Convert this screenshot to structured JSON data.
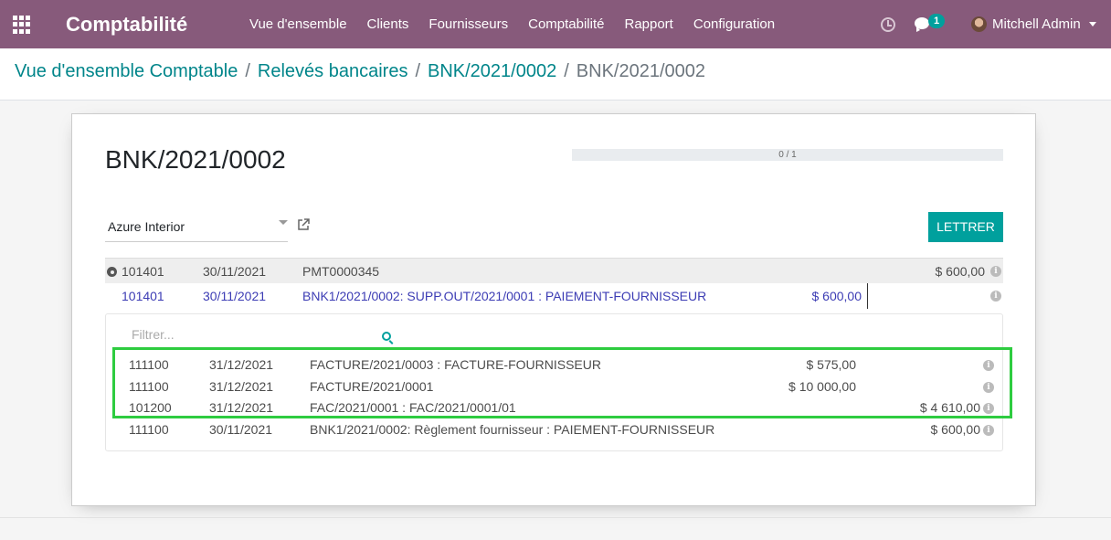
{
  "navbar": {
    "app_title": "Comptabilité",
    "menu": [
      "Vue d'ensemble",
      "Clients",
      "Fournisseurs",
      "Comptabilité",
      "Rapport",
      "Configuration"
    ],
    "chat_badge": "1",
    "user_name": "Mitchell Admin"
  },
  "breadcrumb": {
    "items": [
      "Vue d'ensemble Comptable",
      "Relevés bancaires",
      "BNK/2021/0002"
    ],
    "current": "BNK/2021/0002",
    "separator": "/"
  },
  "sheet": {
    "title": "BNK/2021/0002",
    "progress_text": "0 / 1",
    "progress_fraction": 0,
    "partner": "Azure Interior",
    "reconcile_button": "LETTRER"
  },
  "statement_lines": [
    {
      "account": "101401",
      "date": "30/11/2021",
      "label": "PMT0000345",
      "debit": "",
      "credit": "$ 600,00"
    },
    {
      "account": "101401",
      "date": "30/11/2021",
      "label": "BNK1/2021/0002: SUPP.OUT/2021/0001 : PAIEMENT-FOURNISSEUR",
      "debit": "$ 600,00",
      "credit": ""
    }
  ],
  "matching": {
    "filter_placeholder": "Filtrer...",
    "rows": [
      {
        "account": "111100",
        "date": "31/12/2021",
        "label": "FACTURE/2021/0003 : FACTURE-FOURNISSEUR",
        "debit": "$ 575,00",
        "credit": ""
      },
      {
        "account": "111100",
        "date": "31/12/2021",
        "label": "FACTURE/2021/0001",
        "debit": "$ 10 000,00",
        "credit": ""
      },
      {
        "account": "101200",
        "date": "31/12/2021",
        "label": "FAC/2021/0001 : FAC/2021/0001/01",
        "debit": "",
        "credit": "$ 4 610,00"
      },
      {
        "account": "111100",
        "date": "30/11/2021",
        "label": "BNK1/2021/0002: Règlement fournisseur : PAIEMENT-FOURNISSEUR",
        "debit": "",
        "credit": "$ 600,00"
      }
    ]
  },
  "colors": {
    "navbar": "#875a7b",
    "accent": "#00a09d",
    "link": "#00858a",
    "highlight": "#2ecc40",
    "selected_line": "#3c3cb4"
  }
}
